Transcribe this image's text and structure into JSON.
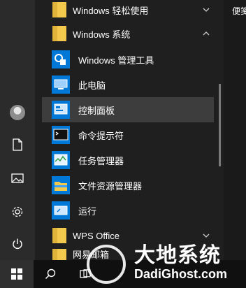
{
  "app_list": {
    "items": [
      {
        "label": "Windows 轻松使用"
      },
      {
        "label": "Windows 系统"
      },
      {
        "label": "Windows 管理工具"
      },
      {
        "label": "此电脑"
      },
      {
        "label": "控制面板"
      },
      {
        "label": "命令提示符"
      },
      {
        "label": "任务管理器"
      },
      {
        "label": "文件资源管理器"
      },
      {
        "label": "运行"
      },
      {
        "label": "WPS Office"
      },
      {
        "label": "网易邮箱"
      }
    ]
  },
  "right_pane": {
    "title": "便笺"
  },
  "watermark": {
    "title": "大地系统",
    "url": "DadiGhost.com"
  },
  "colors": {
    "folder": "#f2c94c",
    "accent": "#0078d7",
    "highlight": "#3d3d3d"
  }
}
